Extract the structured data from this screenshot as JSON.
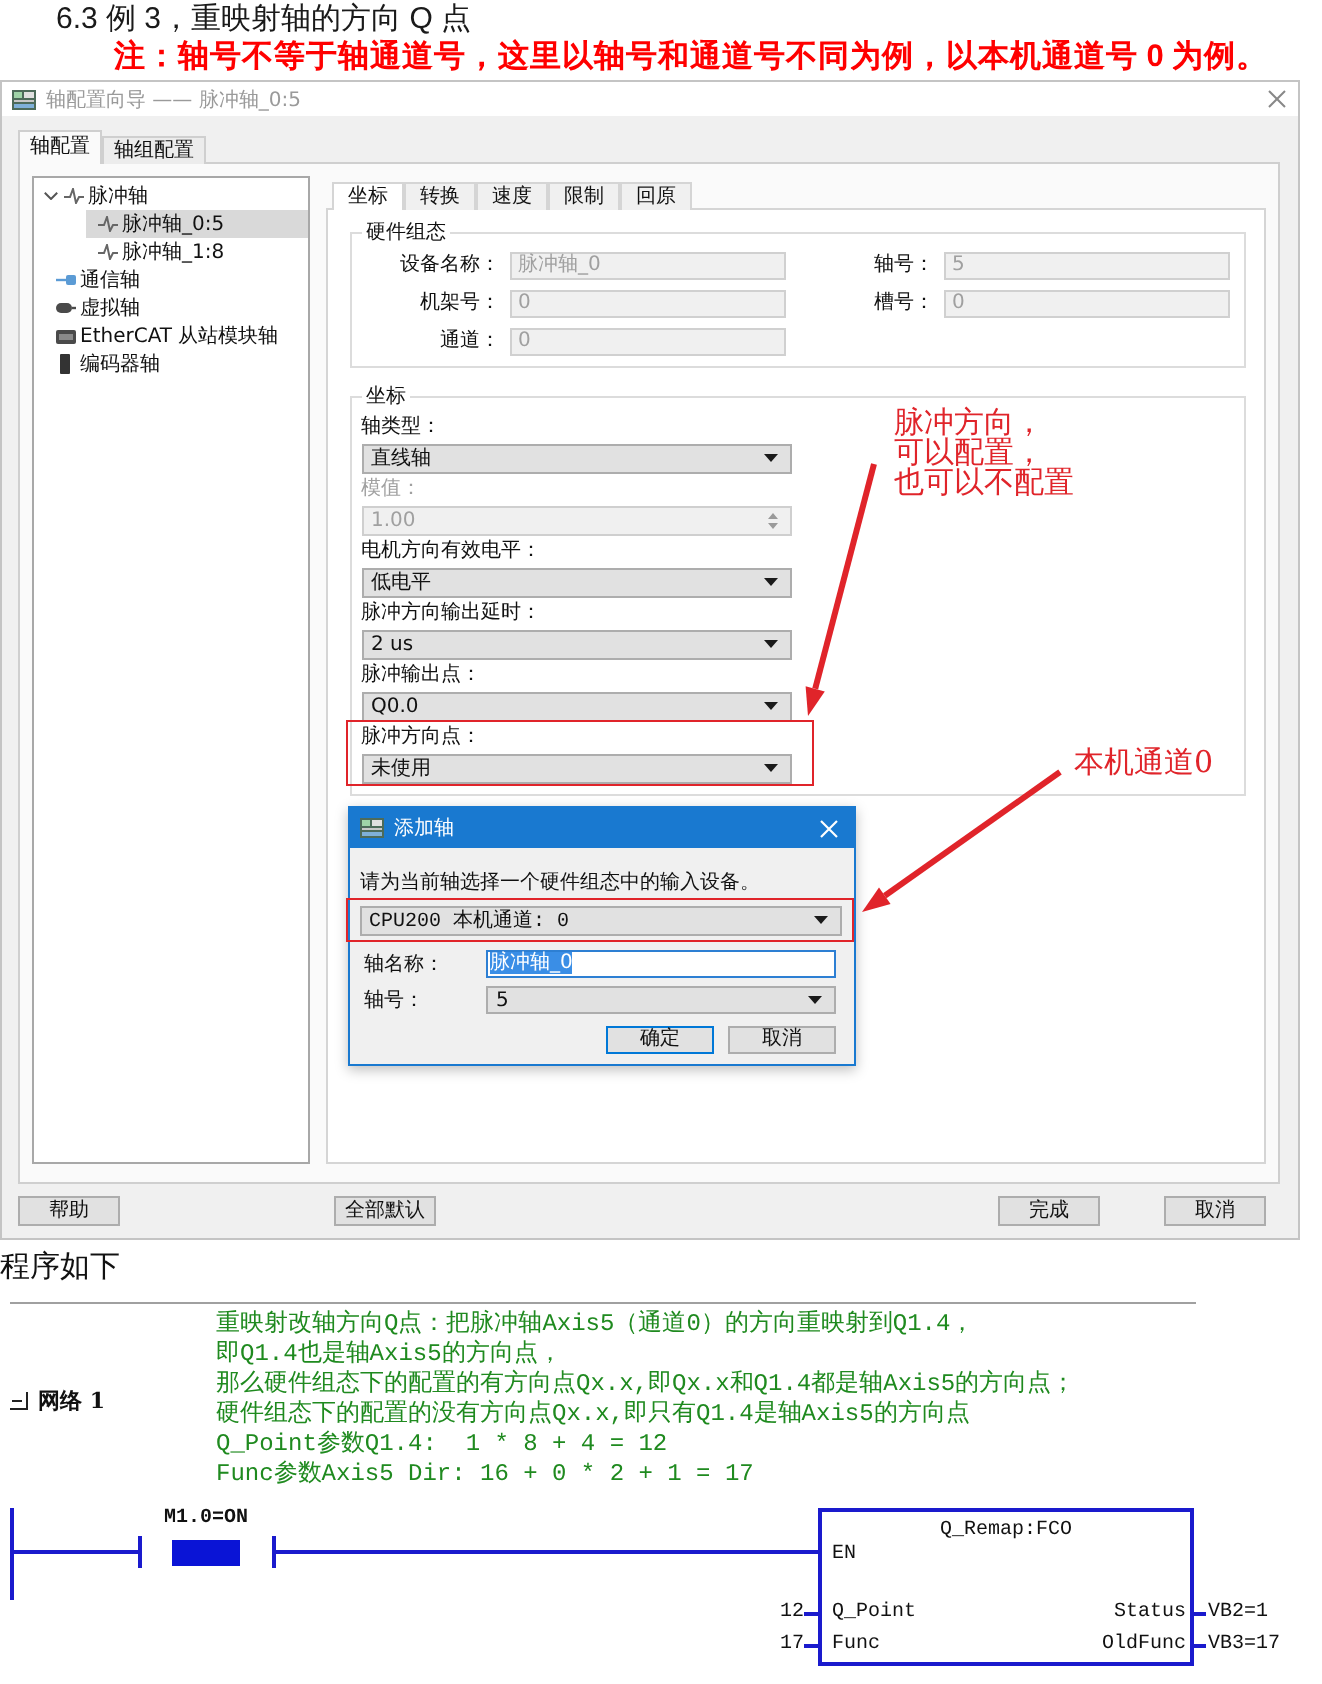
{
  "heading": "6.3 例 3，重映射轴的方向 Q 点",
  "note": "注：轴号不等于轴通道号，这里以轴号和通道号不同为例，以本机通道号 0 为例。",
  "window": {
    "title": "轴配置向导 —— 脉冲轴_0:5",
    "tabs": [
      {
        "label": "轴配置",
        "selected": true
      },
      {
        "label": "轴组配置",
        "selected": false
      }
    ],
    "tree": [
      {
        "label": "脉冲轴",
        "kind": "pulse",
        "selected": false,
        "expanded": true,
        "children": [
          {
            "label": "脉冲轴_0:5",
            "kind": "pulse",
            "selected": true
          },
          {
            "label": "脉冲轴_1:8",
            "kind": "pulse",
            "selected": false
          }
        ]
      },
      {
        "label": "通信轴",
        "kind": "comm",
        "selected": false
      },
      {
        "label": "虚拟轴",
        "kind": "virtual",
        "selected": false
      },
      {
        "label": "EtherCAT 从站模块轴",
        "kind": "ethercat",
        "selected": false
      },
      {
        "label": "编码器轴",
        "kind": "encoder",
        "selected": false
      }
    ],
    "inner_tabs": [
      {
        "label": "坐标",
        "selected": true
      },
      {
        "label": "转换",
        "selected": false
      },
      {
        "label": "速度",
        "selected": false
      },
      {
        "label": "限制",
        "selected": false
      },
      {
        "label": "回原",
        "selected": false
      }
    ],
    "hardware": {
      "title": "硬件组态",
      "rows": [
        [
          {
            "label": "设备名称：",
            "value": "脉冲轴_0",
            "disabled": true
          },
          {
            "label": "轴号：",
            "value": "5",
            "disabled": true
          }
        ],
        [
          {
            "label": "机架号：",
            "value": "0",
            "disabled": true
          },
          {
            "label": "槽号：",
            "value": "0",
            "disabled": true
          }
        ],
        [
          {
            "label": "通道：",
            "value": "0",
            "disabled": true
          }
        ]
      ]
    },
    "coordinates": {
      "title": "坐标",
      "fields": [
        {
          "label": "轴类型：",
          "kind": "combo",
          "value": "直线轴",
          "disabled": false,
          "highlighted": false
        },
        {
          "label": "模值：",
          "kind": "spin",
          "value": "1.00",
          "disabled": true,
          "highlighted": false
        },
        {
          "label": "电机方向有效电平：",
          "kind": "combo",
          "value": "低电平",
          "disabled": false,
          "highlighted": false
        },
        {
          "label": "脉冲方向输出延时：",
          "kind": "combo",
          "value": "2 us",
          "disabled": false,
          "highlighted": false
        },
        {
          "label": "脉冲输出点：",
          "kind": "combo",
          "value": "Q0.0",
          "disabled": false,
          "highlighted": false
        },
        {
          "label": "脉冲方向点：",
          "kind": "combo",
          "value": "未使用",
          "disabled": false,
          "highlighted": true
        }
      ]
    },
    "buttons": [
      "帮助",
      "全部默认",
      "完成",
      "取消"
    ]
  },
  "dialog": {
    "title": "添加轴",
    "prompt": "请为当前轴选择一个硬件组态中的输入设备。",
    "device": {
      "value": "CPU200 本机通道: 0",
      "highlighted": true
    },
    "fields": [
      {
        "label": "轴名称：",
        "kind": "text",
        "value": "脉冲轴_0",
        "text_selected": true
      },
      {
        "label": "轴号：",
        "kind": "combo",
        "value": "5"
      }
    ],
    "buttons": [
      {
        "label": "确定",
        "default": true
      },
      {
        "label": "取消",
        "default": false
      }
    ]
  },
  "annotations": [
    {
      "lines": [
        "脉冲方向，",
        "可以配置，",
        "也可以不配置"
      ]
    },
    {
      "lines": [
        "本机通道0"
      ]
    }
  ],
  "program_heading": "程序如下",
  "ladder": {
    "network": "网络 1",
    "comments": [
      "重映射改轴方向Q点：把脉冲轴Axis5（通道0）的方向重映射到Q1.4，",
      "即Q1.4也是轴Axis5的方向点，",
      "那么硬件组态下的配置的有方向点Qx.x,即Qx.x和Q1.4都是轴Axis5的方向点；",
      "硬件组态下的配置的没有方向点Qx.x,即只有Q1.4是轴Axis5的方向点",
      "Q_Point参数Q1.4:  1 * 8 + 4 = 12",
      "Func参数Axis5 Dir: 16 + 0 * 2 + 1 = 17"
    ],
    "contact": {
      "label": "M1.0=ON",
      "on": true
    },
    "block": {
      "title": "Q_Remap:FCO",
      "enable": "EN",
      "inputs": [
        {
          "name": "Q_Point",
          "value": "12"
        },
        {
          "name": "Func",
          "value": "17"
        }
      ],
      "outputs": [
        {
          "name": "Status",
          "value": "VB2=1"
        },
        {
          "name": "OldFunc",
          "value": "VB3=17"
        }
      ]
    }
  }
}
